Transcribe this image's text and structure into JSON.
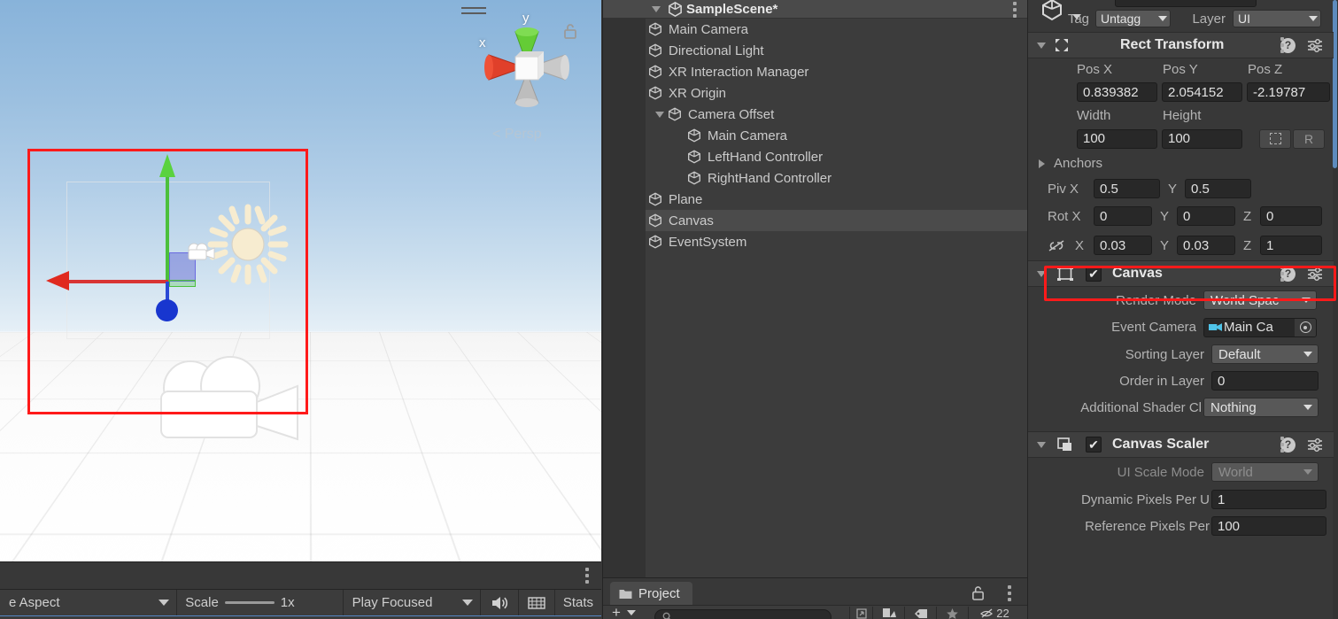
{
  "app": "Unity Editor",
  "scene_view": {
    "gizmo": {
      "axis_x_label": "x",
      "axis_y_label": "y",
      "projection_label": "Persp",
      "projection_arrow": "<",
      "menu_icon": "hamburger-icon",
      "lock_icon": "lock-open-icon"
    },
    "objects": {
      "light_icon": "sun-light-gizmo-icon",
      "camera_icon": "camera-gizmo-icon",
      "scene_camera_icon": "camera-icon",
      "selection_color": "#ff1a1a"
    }
  },
  "game_toolbar": {
    "aspect_label": "e Aspect",
    "scale_label": "Scale",
    "scale_value": "1x",
    "play_mode_label": "Play Focused",
    "mute_icon": "speaker-icon",
    "stats_icon": "grid-icon",
    "stats_label": "Stats",
    "kebab_icon": "kebab-menu-icon"
  },
  "hierarchy": {
    "scene_name": "SampleScene*",
    "kebab_icon": "kebab-menu-icon",
    "items": [
      {
        "label": "Main Camera",
        "depth": 1,
        "twisty": "none",
        "selected": false
      },
      {
        "label": "Directional Light",
        "depth": 1,
        "twisty": "none",
        "selected": false
      },
      {
        "label": "XR Interaction Manager",
        "depth": 1,
        "twisty": "none",
        "selected": false
      },
      {
        "label": "XR Origin",
        "depth": 1,
        "twisty": "down",
        "selected": false
      },
      {
        "label": "Camera Offset",
        "depth": 2,
        "twisty": "down",
        "selected": false
      },
      {
        "label": "Main Camera",
        "depth": 3,
        "twisty": "none",
        "selected": false
      },
      {
        "label": "LeftHand Controller",
        "depth": 3,
        "twisty": "none",
        "selected": false
      },
      {
        "label": "RightHand Controller",
        "depth": 3,
        "twisty": "none",
        "selected": false
      },
      {
        "label": "Plane",
        "depth": 1,
        "twisty": "none",
        "selected": false
      },
      {
        "label": "Canvas",
        "depth": 1,
        "twisty": "none",
        "selected": true
      },
      {
        "label": "EventSystem",
        "depth": 1,
        "twisty": "none",
        "selected": false
      }
    ]
  },
  "project": {
    "tab_label": "Project",
    "folder_icon": "folder-icon",
    "lock_icon": "lock-open-icon",
    "kebab_icon": "kebab-menu-icon",
    "add_icon": "plus-icon",
    "search_placeholder": "",
    "search_value": "",
    "filter_icons": [
      "type-filter-icon",
      "label-filter-icon",
      "favorite-star-icon",
      "hidden-filter-icon"
    ],
    "counter": "22"
  },
  "inspector": {
    "tag_label": "Tag",
    "tag_value": "Untagg",
    "layer_label": "Layer",
    "layer_value": "UI",
    "components": [
      {
        "name": "Rect Transform",
        "icon": "rect-transform-icon",
        "help_icon": "help-icon",
        "preset_icon": "preset-icon",
        "kebab_icon": "kebab-menu-icon",
        "has_checkbox": false
      },
      {
        "name": "Canvas",
        "icon": "canvas-icon",
        "help_icon": "help-icon",
        "preset_icon": "preset-icon",
        "kebab_icon": "kebab-menu-icon",
        "has_checkbox": true,
        "checked": true
      },
      {
        "name": "Canvas Scaler",
        "icon": "canvas-scaler-icon",
        "help_icon": "help-icon",
        "preset_icon": "preset-icon",
        "kebab_icon": "kebab-menu-icon",
        "has_checkbox": true,
        "checked": true
      }
    ],
    "rect_transform": {
      "pos_x_label": "Pos X",
      "pos_x_value": "0.839382",
      "pos_y_label": "Pos Y",
      "pos_y_value": "2.054152",
      "pos_z_label": "Pos Z",
      "pos_z_value": "-2.19787",
      "width_label": "Width",
      "width_value": "100",
      "height_label": "Height",
      "height_value": "100",
      "blueprint_icon": "blueprint-mode-icon",
      "raw_edit_label": "R",
      "anchors_label": "Anchors",
      "pivot_x_label": "Piv X",
      "pivot_x_value": "0.5",
      "pivot_y_label": "Y",
      "pivot_y_value": "0.5",
      "rot_x_label": "Rot X",
      "rot_x_value": "0",
      "rot_y_label": "Y",
      "rot_y_value": "0",
      "rot_z_label": "Z",
      "rot_z_value": "0",
      "scale_link_icon": "link-broken-icon",
      "scale_x_label": "X",
      "scale_x_value": "0.03",
      "scale_y_label": "Y",
      "scale_y_value": "0.03",
      "scale_z_label": "Z",
      "scale_z_value": "1",
      "highlight_color": "#ff1a1a"
    },
    "canvas": {
      "render_mode_label": "Render Mode",
      "render_mode_value": "World Spac",
      "event_camera_label": "Event Camera",
      "event_camera_value": "Main Ca",
      "event_camera_icon": "camera-icon",
      "sorting_layer_label": "Sorting Layer",
      "sorting_layer_value": "Default",
      "order_in_layer_label": "Order in Layer",
      "order_in_layer_value": "0",
      "additional_shader_label": "Additional Shader Cl",
      "additional_shader_value": "Nothing"
    },
    "canvas_scaler": {
      "ui_scale_mode_label": "UI Scale Mode",
      "ui_scale_mode_value": "World",
      "dynamic_pixels_label": "Dynamic Pixels Per U",
      "dynamic_pixels_value": "1",
      "reference_pixels_label": "Reference Pixels Per",
      "reference_pixels_value": "100"
    }
  }
}
